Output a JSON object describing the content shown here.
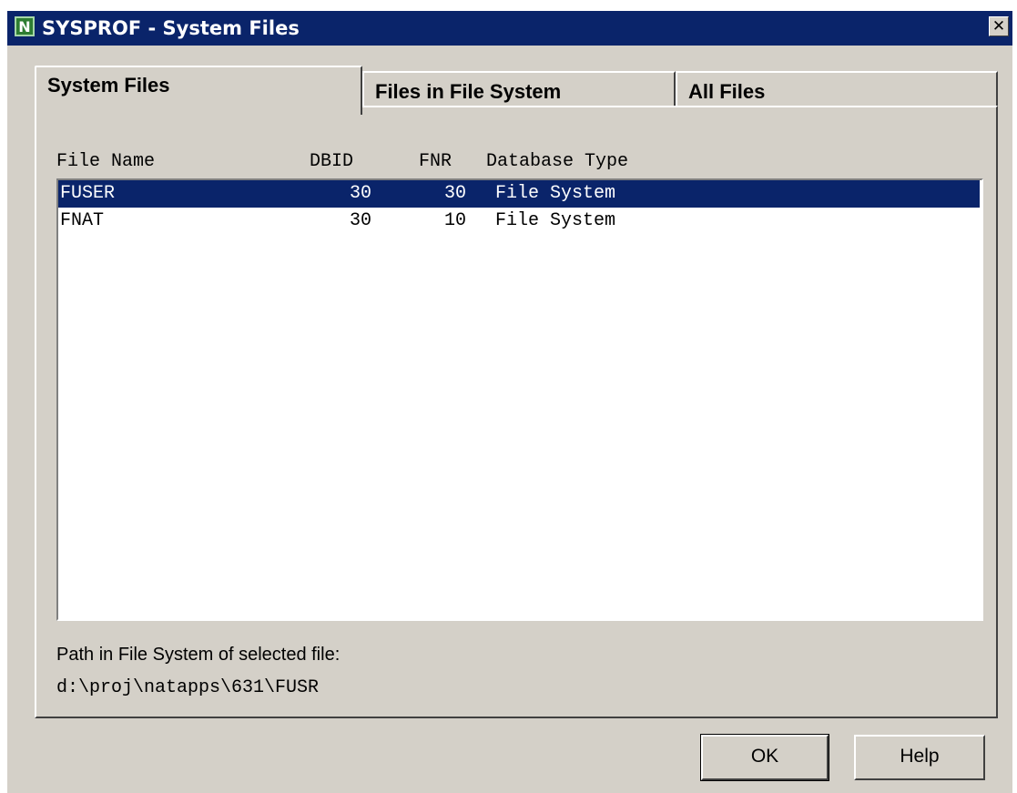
{
  "window": {
    "title": "SYSPROF - System Files",
    "icon": "natural-app-icon",
    "icon_glyph": "N",
    "close_glyph": "✕"
  },
  "tabs": [
    {
      "label": "System Files",
      "active": true
    },
    {
      "label": "Files in File System",
      "active": false
    },
    {
      "label": "All Files",
      "active": false
    }
  ],
  "list": {
    "headers": {
      "file_name": "File Name",
      "dbid": "DBID",
      "fnr": "FNR",
      "database_type": "Database Type"
    },
    "rows": [
      {
        "file_name": "FUSER",
        "dbid": "30",
        "fnr": "30",
        "database_type": "File System",
        "selected": true
      },
      {
        "file_name": "FNAT",
        "dbid": "30",
        "fnr": "10",
        "database_type": "File System",
        "selected": false
      }
    ]
  },
  "path": {
    "label": "Path in File System of selected file:",
    "value": "d:\\proj\\natapps\\631\\FUSR"
  },
  "buttons": {
    "ok": "OK",
    "help": "Help"
  },
  "colors": {
    "titlebar": "#0a246a",
    "selection": "#0a246a",
    "face": "#d4d0c8"
  }
}
